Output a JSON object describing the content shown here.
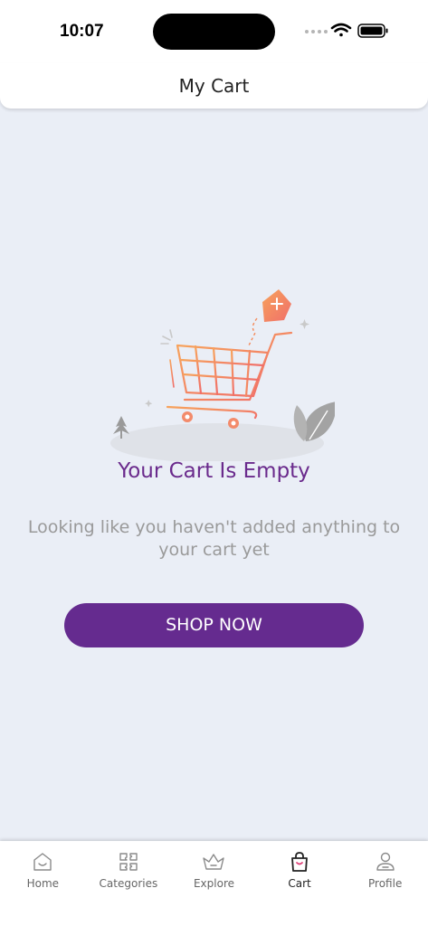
{
  "status_bar": {
    "time": "10:07"
  },
  "header": {
    "title": "My Cart"
  },
  "empty_state": {
    "title": "Your Cart Is Empty",
    "message": "Looking like you haven't added anything to your cart yet",
    "button_label": "SHOP NOW"
  },
  "tabbar": {
    "items": [
      {
        "label": "Home",
        "icon": "home-icon",
        "active": false
      },
      {
        "label": "Categories",
        "icon": "categories-icon",
        "active": false
      },
      {
        "label": "Explore",
        "icon": "crown-icon",
        "active": false
      },
      {
        "label": "Cart",
        "icon": "shopping-bag-icon",
        "active": true
      },
      {
        "label": "Profile",
        "icon": "profile-icon",
        "active": false
      }
    ]
  },
  "colors": {
    "accent": "#652b8f",
    "title": "#6a2a8c",
    "background": "#eaeef6",
    "cart_orange": "#f48a5a"
  }
}
